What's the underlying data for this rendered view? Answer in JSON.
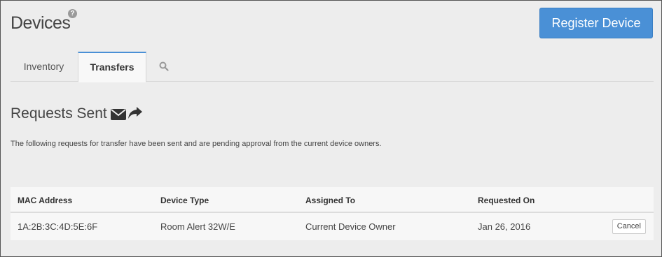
{
  "page": {
    "title": "Devices",
    "help_icon": "?"
  },
  "register_button": {
    "label": "Register Device",
    "color": "#4a90d6"
  },
  "tabs": [
    {
      "label": "Inventory",
      "active": false
    },
    {
      "label": "Transfers",
      "active": true
    }
  ],
  "search_icon": "search-icon",
  "section": {
    "title": "Requests Sent",
    "icons": [
      "envelope-icon",
      "share-arrow-icon"
    ],
    "description": "The following requests for transfer have been sent and are pending approval from the current device owners."
  },
  "table": {
    "columns": [
      "MAC Address",
      "Device Type",
      "Assigned To",
      "Requested On"
    ],
    "rows": [
      {
        "mac": "1A:2B:3C:4D:5E:6F",
        "device_type": "Room Alert 32W/E",
        "assigned_to": "Current Device Owner",
        "requested_on": "Jan 26, 2016",
        "action": "Cancel"
      }
    ]
  }
}
